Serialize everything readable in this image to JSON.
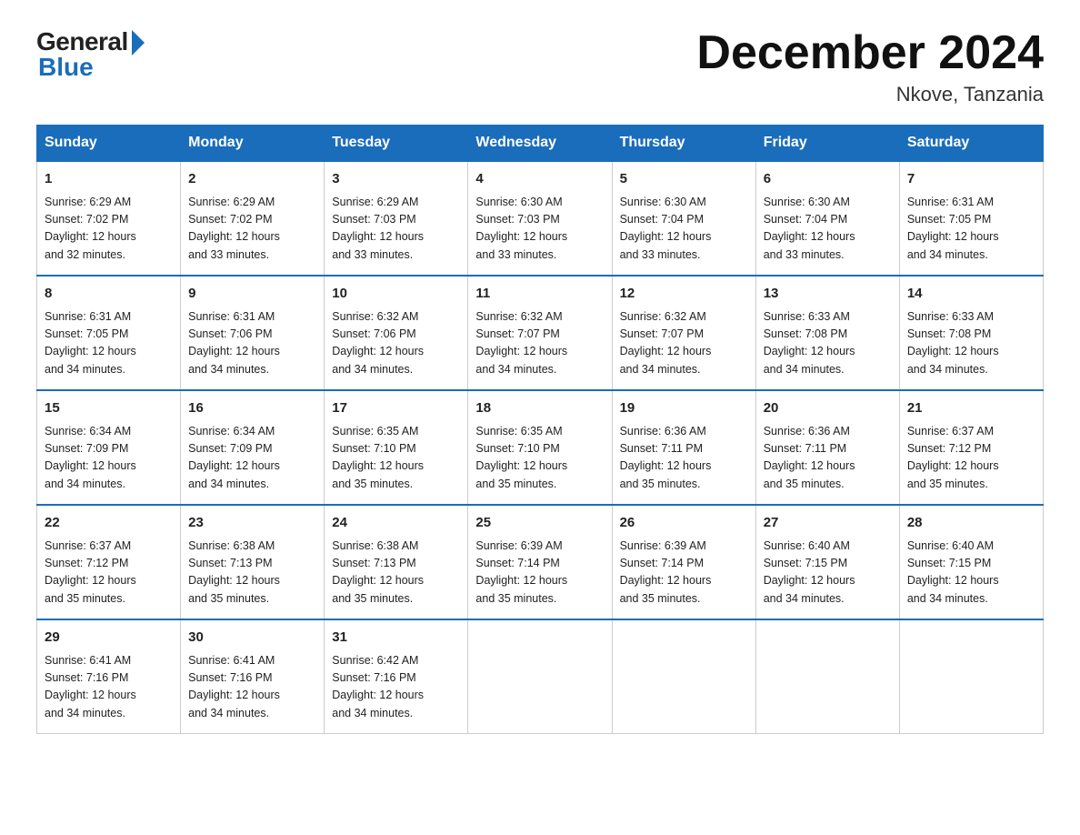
{
  "header": {
    "logo_general": "General",
    "logo_blue": "Blue",
    "month_title": "December 2024",
    "location": "Nkove, Tanzania"
  },
  "weekdays": [
    "Sunday",
    "Monday",
    "Tuesday",
    "Wednesday",
    "Thursday",
    "Friday",
    "Saturday"
  ],
  "weeks": [
    [
      {
        "day": 1,
        "sunrise": "6:29 AM",
        "sunset": "7:02 PM",
        "daylight": "12 hours and 32 minutes."
      },
      {
        "day": 2,
        "sunrise": "6:29 AM",
        "sunset": "7:02 PM",
        "daylight": "12 hours and 33 minutes."
      },
      {
        "day": 3,
        "sunrise": "6:29 AM",
        "sunset": "7:03 PM",
        "daylight": "12 hours and 33 minutes."
      },
      {
        "day": 4,
        "sunrise": "6:30 AM",
        "sunset": "7:03 PM",
        "daylight": "12 hours and 33 minutes."
      },
      {
        "day": 5,
        "sunrise": "6:30 AM",
        "sunset": "7:04 PM",
        "daylight": "12 hours and 33 minutes."
      },
      {
        "day": 6,
        "sunrise": "6:30 AM",
        "sunset": "7:04 PM",
        "daylight": "12 hours and 33 minutes."
      },
      {
        "day": 7,
        "sunrise": "6:31 AM",
        "sunset": "7:05 PM",
        "daylight": "12 hours and 34 minutes."
      }
    ],
    [
      {
        "day": 8,
        "sunrise": "6:31 AM",
        "sunset": "7:05 PM",
        "daylight": "12 hours and 34 minutes."
      },
      {
        "day": 9,
        "sunrise": "6:31 AM",
        "sunset": "7:06 PM",
        "daylight": "12 hours and 34 minutes."
      },
      {
        "day": 10,
        "sunrise": "6:32 AM",
        "sunset": "7:06 PM",
        "daylight": "12 hours and 34 minutes."
      },
      {
        "day": 11,
        "sunrise": "6:32 AM",
        "sunset": "7:07 PM",
        "daylight": "12 hours and 34 minutes."
      },
      {
        "day": 12,
        "sunrise": "6:32 AM",
        "sunset": "7:07 PM",
        "daylight": "12 hours and 34 minutes."
      },
      {
        "day": 13,
        "sunrise": "6:33 AM",
        "sunset": "7:08 PM",
        "daylight": "12 hours and 34 minutes."
      },
      {
        "day": 14,
        "sunrise": "6:33 AM",
        "sunset": "7:08 PM",
        "daylight": "12 hours and 34 minutes."
      }
    ],
    [
      {
        "day": 15,
        "sunrise": "6:34 AM",
        "sunset": "7:09 PM",
        "daylight": "12 hours and 34 minutes."
      },
      {
        "day": 16,
        "sunrise": "6:34 AM",
        "sunset": "7:09 PM",
        "daylight": "12 hours and 34 minutes."
      },
      {
        "day": 17,
        "sunrise": "6:35 AM",
        "sunset": "7:10 PM",
        "daylight": "12 hours and 35 minutes."
      },
      {
        "day": 18,
        "sunrise": "6:35 AM",
        "sunset": "7:10 PM",
        "daylight": "12 hours and 35 minutes."
      },
      {
        "day": 19,
        "sunrise": "6:36 AM",
        "sunset": "7:11 PM",
        "daylight": "12 hours and 35 minutes."
      },
      {
        "day": 20,
        "sunrise": "6:36 AM",
        "sunset": "7:11 PM",
        "daylight": "12 hours and 35 minutes."
      },
      {
        "day": 21,
        "sunrise": "6:37 AM",
        "sunset": "7:12 PM",
        "daylight": "12 hours and 35 minutes."
      }
    ],
    [
      {
        "day": 22,
        "sunrise": "6:37 AM",
        "sunset": "7:12 PM",
        "daylight": "12 hours and 35 minutes."
      },
      {
        "day": 23,
        "sunrise": "6:38 AM",
        "sunset": "7:13 PM",
        "daylight": "12 hours and 35 minutes."
      },
      {
        "day": 24,
        "sunrise": "6:38 AM",
        "sunset": "7:13 PM",
        "daylight": "12 hours and 35 minutes."
      },
      {
        "day": 25,
        "sunrise": "6:39 AM",
        "sunset": "7:14 PM",
        "daylight": "12 hours and 35 minutes."
      },
      {
        "day": 26,
        "sunrise": "6:39 AM",
        "sunset": "7:14 PM",
        "daylight": "12 hours and 35 minutes."
      },
      {
        "day": 27,
        "sunrise": "6:40 AM",
        "sunset": "7:15 PM",
        "daylight": "12 hours and 34 minutes."
      },
      {
        "day": 28,
        "sunrise": "6:40 AM",
        "sunset": "7:15 PM",
        "daylight": "12 hours and 34 minutes."
      }
    ],
    [
      {
        "day": 29,
        "sunrise": "6:41 AM",
        "sunset": "7:16 PM",
        "daylight": "12 hours and 34 minutes."
      },
      {
        "day": 30,
        "sunrise": "6:41 AM",
        "sunset": "7:16 PM",
        "daylight": "12 hours and 34 minutes."
      },
      {
        "day": 31,
        "sunrise": "6:42 AM",
        "sunset": "7:16 PM",
        "daylight": "12 hours and 34 minutes."
      },
      null,
      null,
      null,
      null
    ]
  ],
  "labels": {
    "sunrise": "Sunrise:",
    "sunset": "Sunset:",
    "daylight": "Daylight:"
  }
}
